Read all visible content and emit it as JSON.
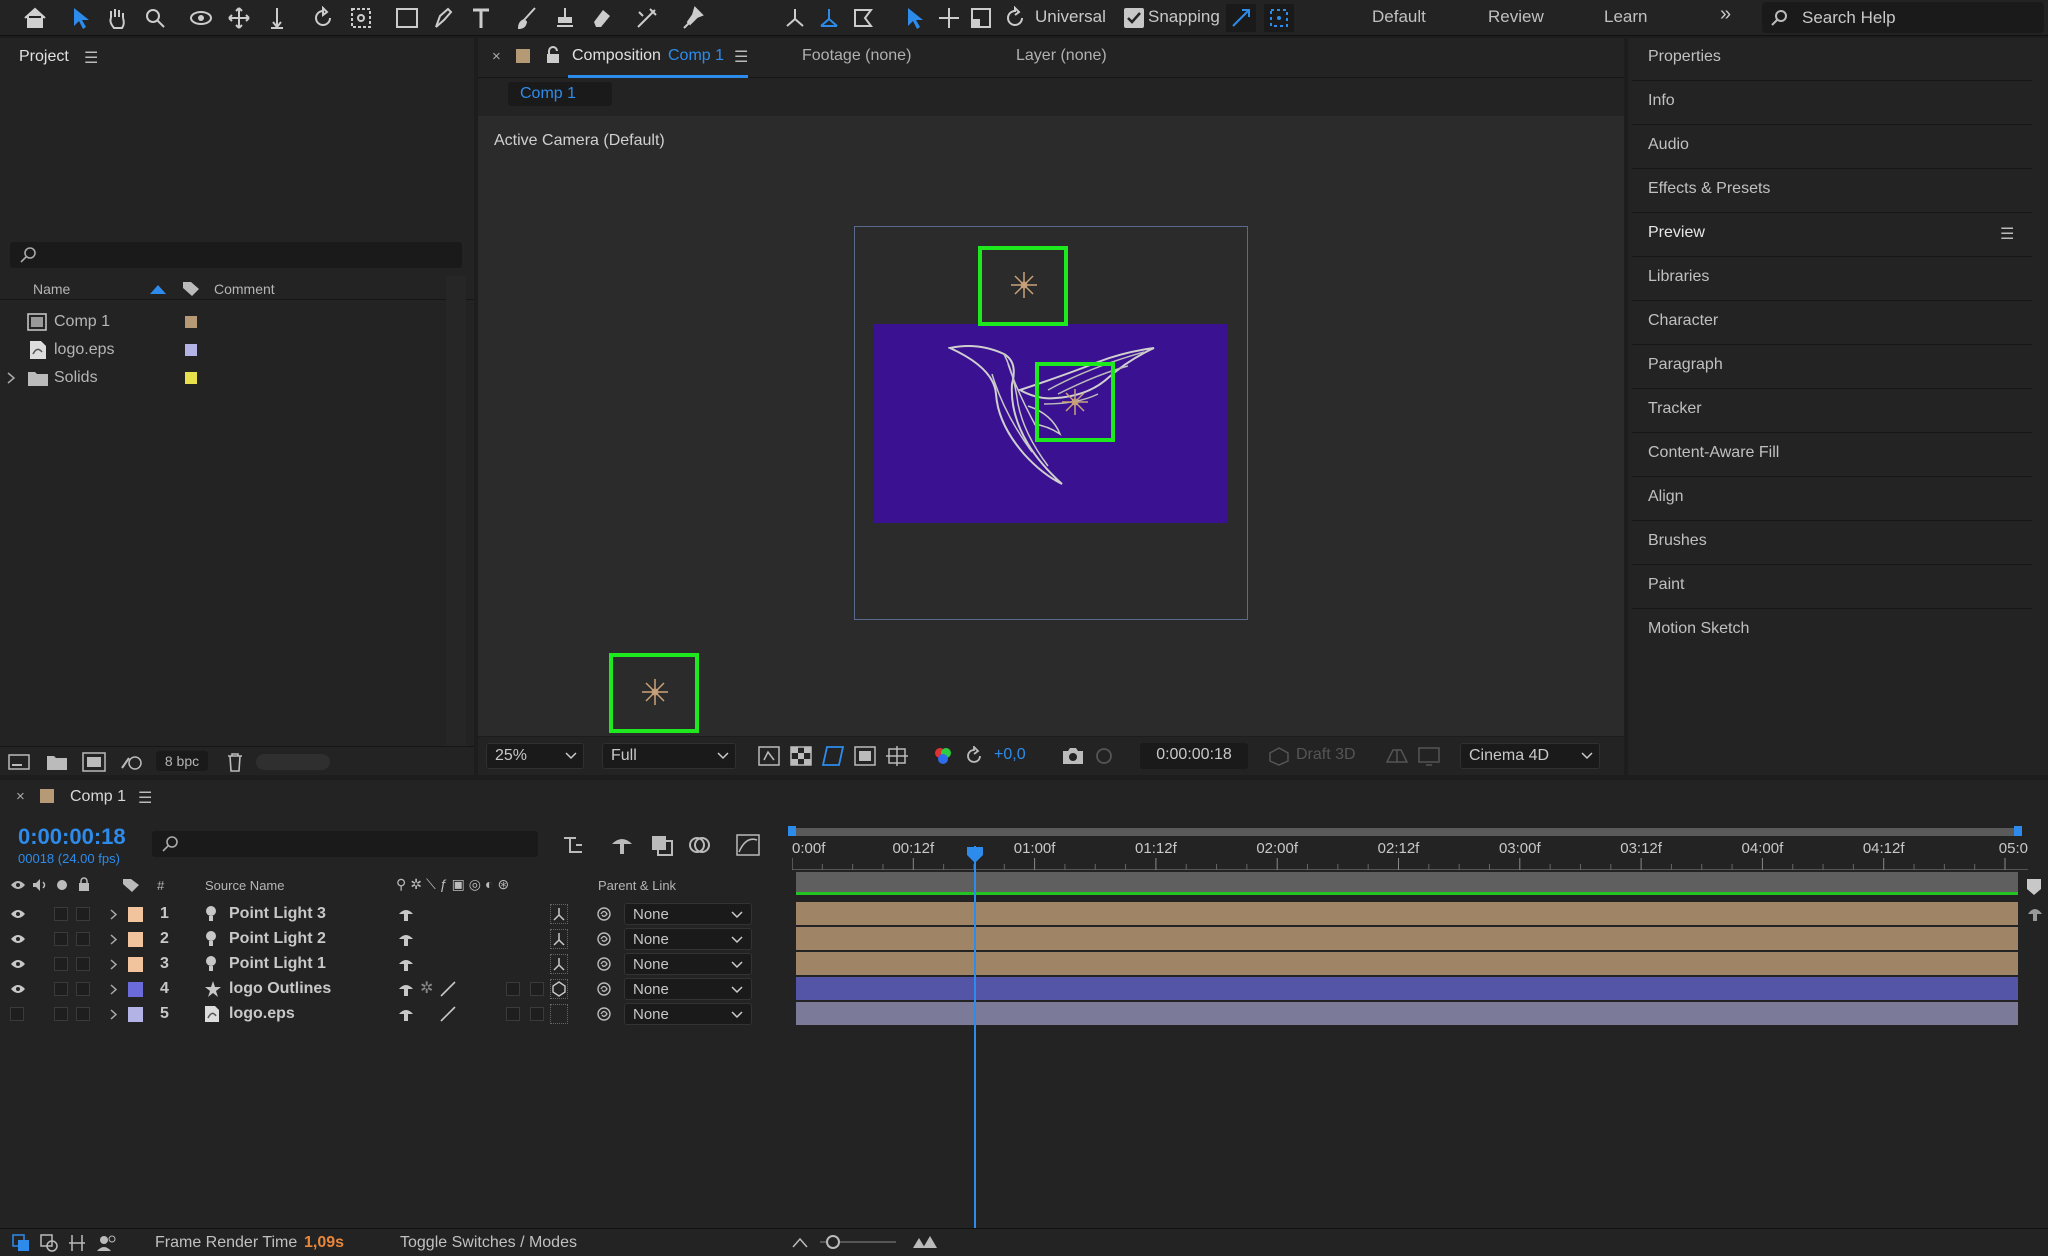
{
  "toolbar": {
    "universal_label": "Universal",
    "snapping_label": "Snapping",
    "snapping_checked": true,
    "workspaces": [
      "Default",
      "Review",
      "Learn"
    ],
    "search_placeholder": "Search Help"
  },
  "project": {
    "title": "Project",
    "columns": {
      "name": "Name",
      "comment": "Comment"
    },
    "items": [
      {
        "name": "Comp 1",
        "icon": "composition-icon",
        "label_color": "#b69a76"
      },
      {
        "name": "logo.eps",
        "icon": "eps-file-icon",
        "label_color": "#b3b3e6"
      },
      {
        "name": "Solids",
        "icon": "folder-icon",
        "label_color": "#e8e04a"
      }
    ],
    "bpc": "8 bpc"
  },
  "composition": {
    "tab_prefix": "Composition",
    "tab_name": "Comp 1",
    "footage_tab": "Footage (none)",
    "layer_tab": "Layer (none)",
    "sub_tab": "Comp 1",
    "camera_label": "Active Camera (Default)",
    "bg_color": "#3a1190"
  },
  "viewer_controls": {
    "zoom": "25%",
    "resolution": "Full",
    "exposure": "+0,0",
    "timecode": "0:00:00:18",
    "draft3d": "Draft 3D",
    "renderer": "Cinema 4D"
  },
  "right_panels": [
    "Properties",
    "Info",
    "Audio",
    "Effects & Presets",
    "Preview",
    "Libraries",
    "Character",
    "Paragraph",
    "Tracker",
    "Content-Aware Fill",
    "Align",
    "Brushes",
    "Paint",
    "Motion Sketch"
  ],
  "timeline": {
    "tab_name": "Comp 1",
    "current_time": "0:00:00:18",
    "frame_info": "00018 (24.00 fps)",
    "columns": {
      "number": "#",
      "source_name": "Source Name",
      "parent": "Parent & Link"
    },
    "ruler_labels": [
      "0:00f",
      "00:12f",
      "01:00f",
      "01:12f",
      "02:00f",
      "02:12f",
      "03:00f",
      "03:12f",
      "04:00f",
      "04:12f",
      "05:0"
    ],
    "current_frame": 18,
    "frames_per_second": 24,
    "layers": [
      {
        "num": "1",
        "name": "Point Light 3",
        "type": "light",
        "label_color": "#f2c49d",
        "parent": "None",
        "bar_color": "#9f8466",
        "visible": true
      },
      {
        "num": "2",
        "name": "Point Light 2",
        "type": "light",
        "label_color": "#f2c49d",
        "parent": "None",
        "bar_color": "#9f8466",
        "visible": true
      },
      {
        "num": "3",
        "name": "Point Light 1",
        "type": "light",
        "label_color": "#f2c49d",
        "parent": "None",
        "bar_color": "#9f8466",
        "visible": true
      },
      {
        "num": "4",
        "name": "logo Outlines",
        "type": "shape",
        "label_color": "#6b6bdc",
        "parent": "None",
        "bar_color": "#5555a8",
        "visible": true
      },
      {
        "num": "5",
        "name": "logo.eps",
        "type": "footage",
        "label_color": "#b3b3e6",
        "parent": "None",
        "bar_color": "#7b7b99",
        "visible": false
      }
    ]
  },
  "status": {
    "render_label": "Frame Render Time",
    "render_value": "1,09s",
    "toggle_label": "Toggle Switches / Modes"
  }
}
